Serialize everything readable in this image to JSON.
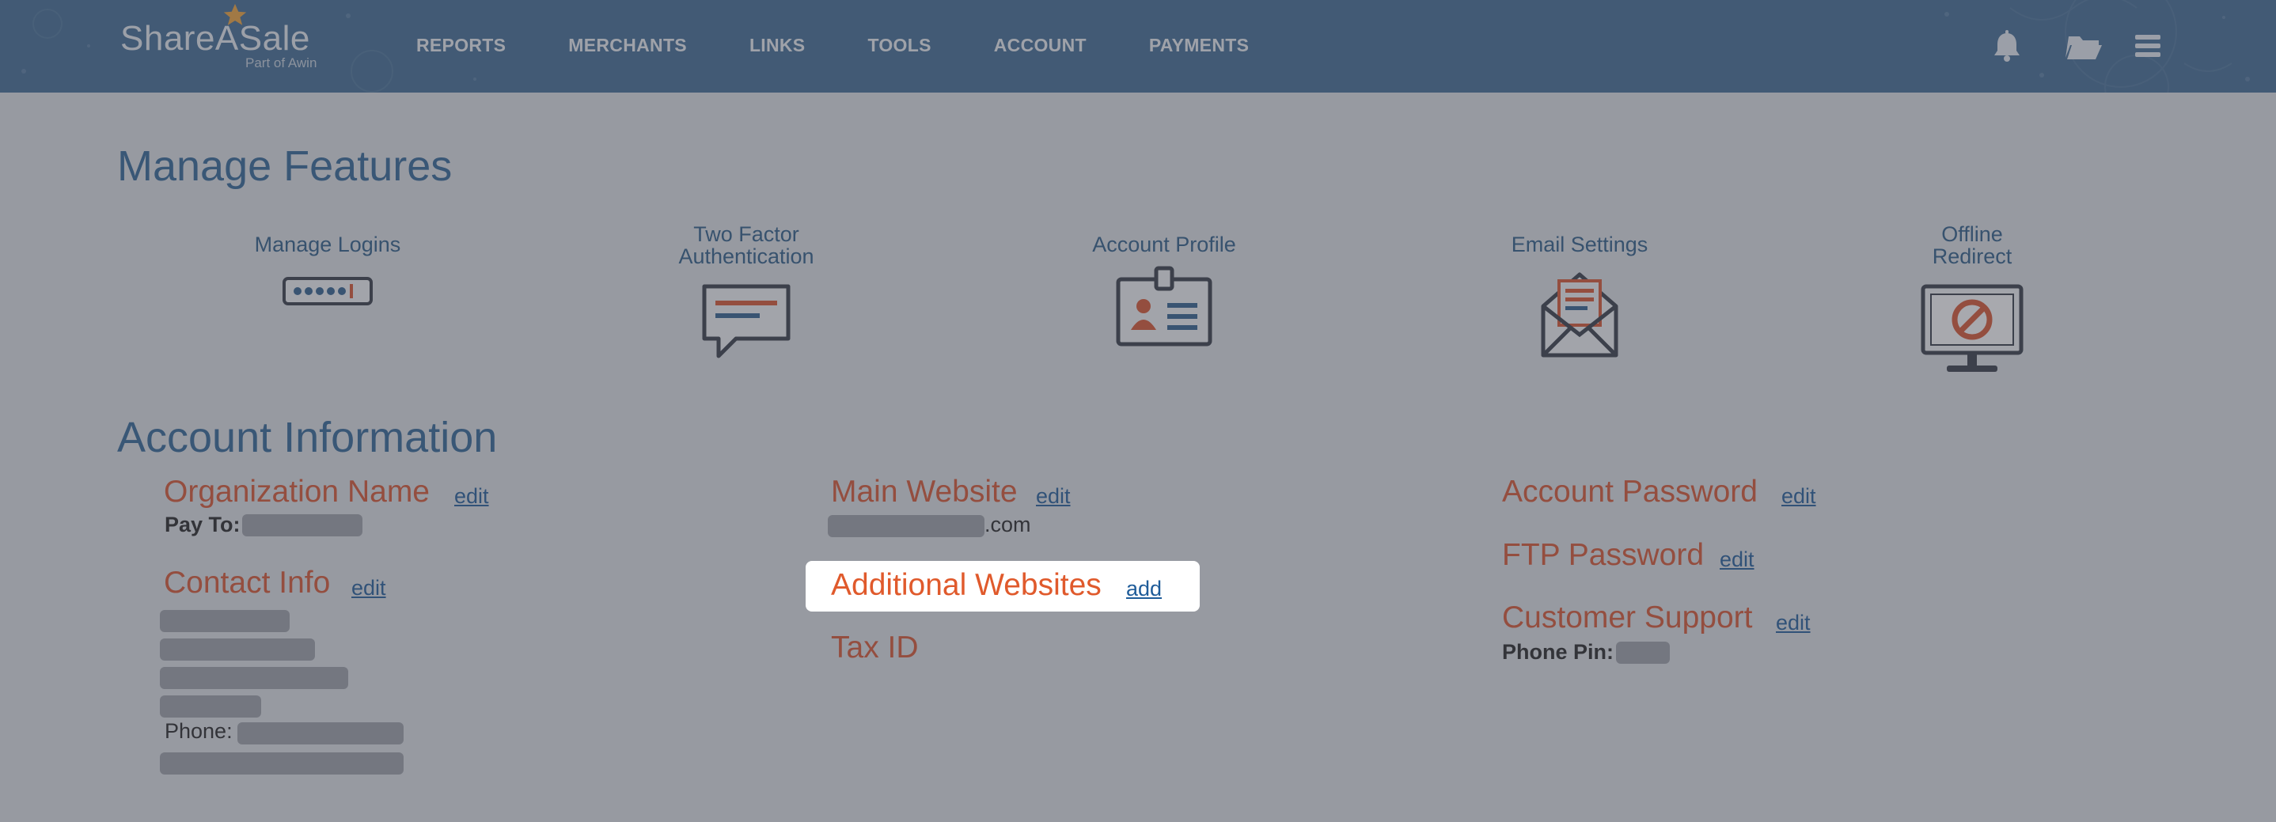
{
  "header": {
    "logo_text": "ShareASale",
    "logo_subtext": "Part of Awin",
    "nav": [
      "REPORTS",
      "MERCHANTS",
      "LINKS",
      "TOOLS",
      "ACCOUNT",
      "PAYMENTS"
    ],
    "icons": [
      "bell-icon",
      "folder-icon",
      "menu-icon"
    ]
  },
  "features": {
    "title": "Manage Features",
    "items": [
      {
        "label": "Manage Logins",
        "icon": "password-icon"
      },
      {
        "label": "Two Factor\nAuthentication",
        "icon": "chat-bubble-icon"
      },
      {
        "label": "Account Profile",
        "icon": "id-badge-icon"
      },
      {
        "label": "Email Settings",
        "icon": "envelope-icon"
      },
      {
        "label": "Offline\nRedirect",
        "icon": "blocked-monitor-icon"
      }
    ]
  },
  "account_info": {
    "title": "Account Information",
    "organization_name": {
      "title": "Organization Name",
      "action": "edit",
      "pay_to_label": "Pay To:"
    },
    "contact_info": {
      "title": "Contact Info",
      "action": "edit",
      "phone_label": "Phone:"
    },
    "main_website": {
      "title": "Main Website",
      "action": "edit",
      "url_suffix": ".com"
    },
    "additional_websites": {
      "title": "Additional Websites",
      "action": "add"
    },
    "tax_id": {
      "title": "Tax ID"
    },
    "account_password": {
      "title": "Account Password",
      "action": "edit"
    },
    "ftp_password": {
      "title": "FTP Password",
      "action": "edit"
    },
    "customer_support": {
      "title": "Customer Support",
      "action": "edit",
      "phone_pin_label": "Phone Pin:"
    }
  },
  "colors": {
    "header_bg": "#3f6a93",
    "section_title": "#2f6496",
    "field_title": "#d9532f",
    "link": "#1f5c99",
    "overlay": "rgba(70,72,82,0.47)"
  }
}
